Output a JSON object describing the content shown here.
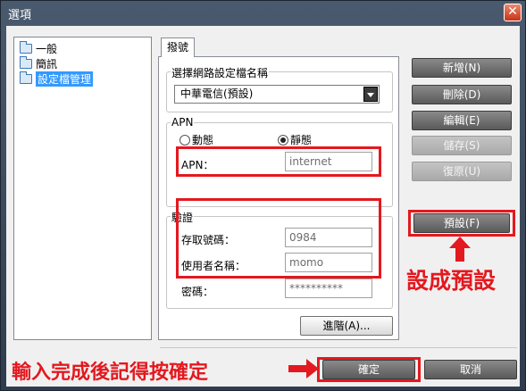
{
  "window": {
    "title": "選項",
    "close_symbol": "✕"
  },
  "tree": {
    "items": [
      {
        "label": "一般",
        "selected": false
      },
      {
        "label": "簡訊",
        "selected": false
      },
      {
        "label": "設定檔管理",
        "selected": true
      }
    ]
  },
  "tab": {
    "label": "撥號"
  },
  "profile_group": {
    "title": "選擇網路設定檔名稱",
    "selected_value": "中華電信(預設)"
  },
  "apn_group": {
    "title": "APN",
    "radio_dynamic": "動態",
    "radio_static": "靜態",
    "selected": "靜態",
    "apn_label": "APN：",
    "apn_value": "internet"
  },
  "auth_group": {
    "title": "驗證",
    "number_label": "存取號碼：",
    "number_value": "0984",
    "username_label": "使用者名稱：",
    "username_value": "momo",
    "password_label": "密碼：",
    "password_value": "**********"
  },
  "buttons": {
    "add": "新增(N)",
    "delete": "刪除(D)",
    "edit": "編輯(E)",
    "save": "儲存(S)",
    "restore": "復原(U)",
    "default": "預設(F)",
    "advanced": "進階(A)...",
    "ok": "確定",
    "cancel": "取消"
  },
  "annotations": {
    "set_default": "設成預設",
    "confirm_hint": "輸入完成後記得按確定"
  },
  "colors": {
    "highlight_red": "#e4181f",
    "selection_blue": "#3399ff"
  }
}
